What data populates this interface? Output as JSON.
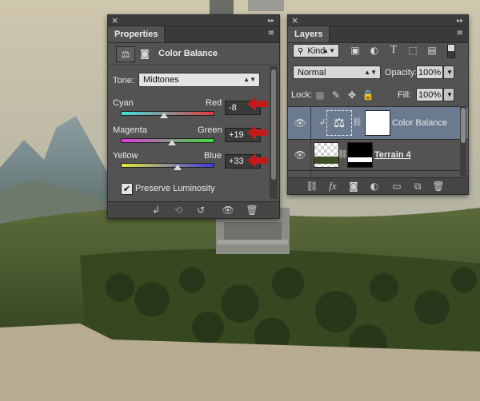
{
  "properties": {
    "close_glyph": "×",
    "tab_label": "Properties",
    "adjustment_title": "Color Balance",
    "tone_label": "Tone:",
    "tone_value": "Midtones",
    "sliders": [
      {
        "left_label": "Cyan",
        "right_label": "Red",
        "value": "-8",
        "fraction": 0.47
      },
      {
        "left_label": "Magenta",
        "right_label": "Green",
        "value": "+19",
        "fraction": 0.56
      },
      {
        "left_label": "Yellow",
        "right_label": "Blue",
        "value": "+33",
        "fraction": 0.62
      }
    ],
    "preserve_luminosity_label": "Preserve Luminosity",
    "preserve_luminosity_checked": true
  },
  "layers": {
    "close_glyph": "×",
    "tab_label": "Layers",
    "filter_kind": "Kind",
    "blend_mode": "Normal",
    "opacity_label": "Opacity:",
    "opacity_value": "100%",
    "lock_label": "Lock:",
    "fill_label": "Fill:",
    "fill_value": "100%",
    "items": [
      {
        "name": "Color Balance",
        "selected": true
      },
      {
        "name": "Terrain 4",
        "selected": false
      }
    ]
  },
  "colors": {
    "panel_bg": "#535353",
    "selected_row": "#6b7a8f",
    "annotation_arrow": "#c41a1a"
  }
}
